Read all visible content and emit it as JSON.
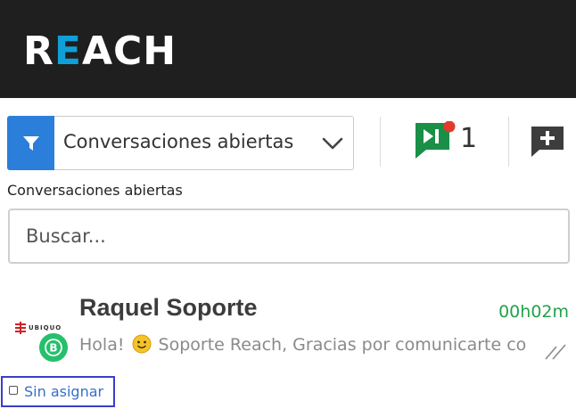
{
  "header": {
    "logo_prefix": "R",
    "logo_e": "E",
    "logo_suffix": "ACH",
    "background": "#1f1f1f",
    "accent": "#0fa0d9"
  },
  "toolbar": {
    "filter_icon": "funnel-icon",
    "filter_select_value": "Conversaciones abiertas",
    "queue_icon": "queue-play-icon",
    "queue_count": "1",
    "new_chat_icon": "add-chat-icon"
  },
  "section_label": "Conversaciones abiertas",
  "search": {
    "placeholder": "Buscar...",
    "value": ""
  },
  "conversations": [
    {
      "company_tag": "UBIQUO",
      "channel_icon": "whatsapp-business-icon",
      "name": "Raquel Soporte",
      "elapsed": "00h02m",
      "preview_start": "Hola!",
      "preview_emoji": "smiley-emoji",
      "preview_rest": "Soporte Reach, Gracias por comunicarte co",
      "status_icon": "double-check-icon",
      "assign_label": "Sin asignar",
      "assigned": false
    }
  ],
  "colors": {
    "filter_button": "#2b7fda",
    "queue_icon": "#1a8f47",
    "notification_dot": "#e23b2e",
    "timer": "#21a34a",
    "assign_border": "#3a3fc8",
    "assign_text": "#3570c8"
  }
}
